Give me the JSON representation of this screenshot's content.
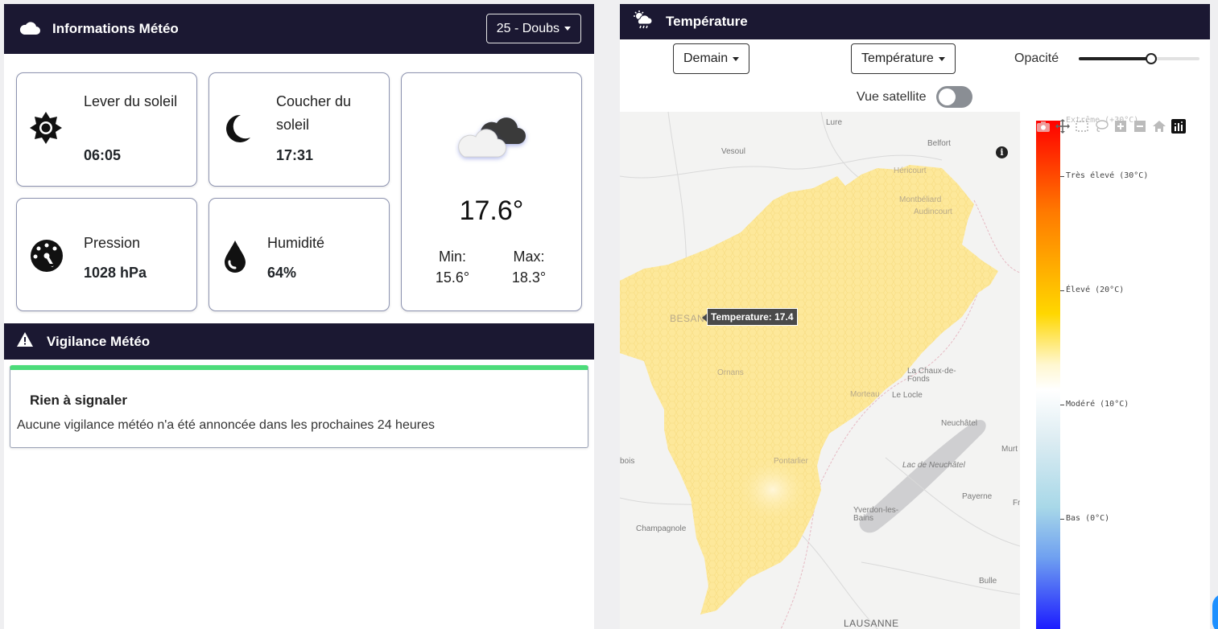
{
  "weather_panel": {
    "title": "Informations Météo",
    "department": "25 - Doubs",
    "sunrise": {
      "label": "Lever du soleil",
      "value": "06:05"
    },
    "sunset": {
      "label": "Coucher du soleil",
      "value": "17:31"
    },
    "pressure": {
      "label": "Pression",
      "value": "1028 hPa"
    },
    "humidity": {
      "label": "Humidité",
      "value": "64%"
    },
    "current": {
      "temperature": "17.6°",
      "min_label": "Min:",
      "min_value": "15.6°",
      "max_label": "Max:",
      "max_value": "18.3°"
    }
  },
  "vigilance": {
    "title": "Vigilance Météo",
    "status_title": "Rien à signaler",
    "status_text": "Aucune vigilance météo n'a été annoncée dans les prochaines 24 heures",
    "status_color": "#4cdc7a"
  },
  "temperature_panel": {
    "title": "Température",
    "day_select": "Demain",
    "layer_select": "Température",
    "opacity_label": "Opacité",
    "opacity_value": 0.6,
    "satellite_label": "Vue satellite",
    "satellite_on": false,
    "tooltip": "Temperature: 17.4",
    "colorbar": [
      {
        "label": "Extrême (+30°C)"
      },
      {
        "label": "Très élevé (30°C)"
      },
      {
        "label": "Élevé (20°C)"
      },
      {
        "label": "Modéré (10°C)"
      },
      {
        "label": "Bas (0°C)"
      }
    ],
    "cities": [
      "Lure",
      "Vesoul",
      "Belfort",
      "Héricourt",
      "Montbéliard",
      "Audincourt",
      "BESANÇON",
      "Ornans",
      "La Chaux-de-Fonds",
      "Morteau",
      "Le Locle",
      "Neuchâtel",
      "Lac de Neuchâtel",
      "Pontarlier",
      "Yverdon-les-Bains",
      "Payerne",
      "Champagnole",
      "Bulle",
      "LAUSANNE",
      "Murt",
      "Fr",
      "bois"
    ]
  },
  "colors": {
    "header_bg": "#1b1832",
    "accent_green": "#4cdc7a",
    "map_fill": "#fde89a"
  },
  "icons": [
    "cloud-icon",
    "sun-icon",
    "moon-icon",
    "gauge-icon",
    "droplet-icon",
    "cloudy-icon",
    "warning-icon",
    "cloud-sun-rain-icon",
    "info-icon",
    "camera-icon",
    "pan-icon",
    "box-select-icon",
    "lasso-icon",
    "zoom-in-icon",
    "zoom-out-icon",
    "home-icon",
    "plotly-logo-icon"
  ]
}
